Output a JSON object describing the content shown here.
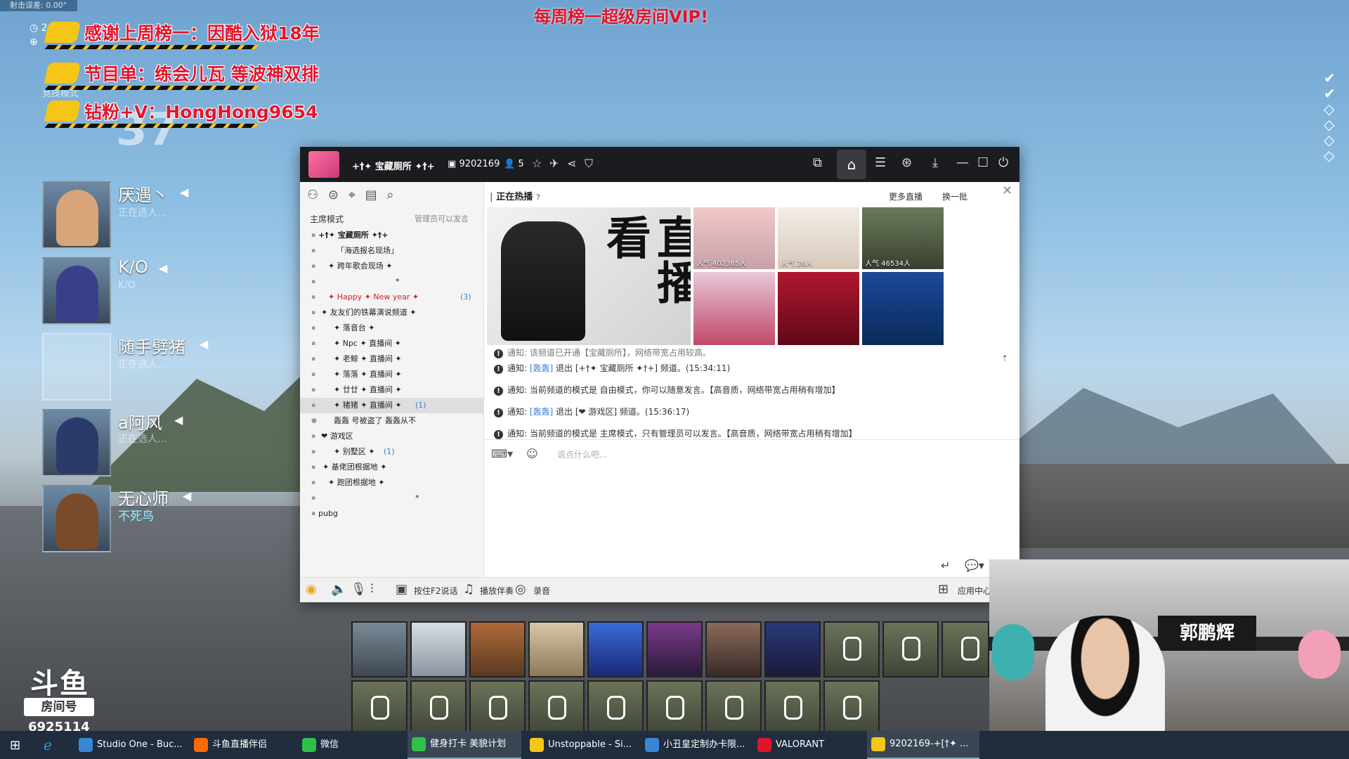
{
  "overlay": {
    "top_banner": "每周榜一超级房间VIP!",
    "tiny_label": "射击误差: 0.00°",
    "ticker": [
      "感谢上周榜一：因酷入狱18年",
      "节目单：练会儿瓦 等波神双排",
      "钻粉+V：HongHong9654"
    ],
    "hud_mode": "竞技模式",
    "hud_number": "37",
    "hud_time": "24"
  },
  "team": [
    {
      "name": "厌遇丶",
      "sub": "正在选人..."
    },
    {
      "name": "K/O",
      "sub": "K/O"
    },
    {
      "name": "随手劈猪",
      "sub": "正在选人..."
    },
    {
      "name": "a阿风",
      "sub": "正在选人..."
    },
    {
      "name": "无心师",
      "sub": "不死鸟"
    }
  ],
  "douyu": {
    "logo": "斗鱼",
    "room_label": "房间号",
    "room_number": "6925114"
  },
  "yy": {
    "title": "+†✦ 宝藏厕所 ✦†+",
    "channel_id": "9202169",
    "online": "5",
    "mode": "主席模式",
    "admin_note": "管理员可以发言",
    "tree": [
      {
        "text": "+†✦ 宝藏厕所 ✦†+",
        "indent": 26,
        "bold": true
      },
      {
        "text": "「海选报名现场」",
        "indent": 52
      },
      {
        "text": "✦ 跨年歌会现场 ✦",
        "indent": 40
      },
      {
        "text": "*",
        "indent": 136
      },
      {
        "text": "✦ Happy ✦ New year ✦",
        "indent": 40,
        "red": true,
        "count": "(3)"
      },
      {
        "text": "✦ 友友们的铁幕演说频道 ✦",
        "indent": 30
      },
      {
        "text": "✦ 落音台 ✦",
        "indent": 48
      },
      {
        "text": "✦ Npc ✦ 直播间 ✦",
        "indent": 48
      },
      {
        "text": "✦ 老鲸 ✦ 直播间 ✦",
        "indent": 48
      },
      {
        "text": "✦ 落落 ✦ 直播间 ✦",
        "indent": 48
      },
      {
        "text": "✦ 廿廿 ✦ 直播间 ✦",
        "indent": 48
      },
      {
        "text": "✦ 猪猪 ✦ 直播间 ✦",
        "indent": 48,
        "count": "(1)",
        "sel": true
      },
      {
        "text": "轰轰 号被盗了 轰轰从不",
        "indent": 48,
        "user": true
      },
      {
        "text": "❤ 游戏区",
        "indent": 30
      },
      {
        "text": "✦ 别墅区 ✦",
        "indent": 48,
        "count": "(1)"
      },
      {
        "text": "✦ 基佬团根据地 ✦",
        "indent": 32
      },
      {
        "text": "✦ 跑团根据地 ✦",
        "indent": 40
      },
      {
        "text": "*",
        "indent": 164
      },
      {
        "text": "pubg",
        "indent": 26
      }
    ],
    "hot": {
      "title": "正在热播",
      "more": "更多直播",
      "refresh": "换一批",
      "big_text": "直播看",
      "viewers": [
        "人气 402365人",
        "人气 26人",
        "人气 46534人"
      ]
    },
    "messages": [
      {
        "pre": "通知: ",
        "name": "",
        "text": "该频道已开通【宝藏厕所】，网络带宽占用较高。"
      },
      {
        "pre": "通知: ",
        "name": "[轰轰]",
        "text": " 退出 [+†✦ 宝藏厕所 ✦†+] 频道。(15:34:11)"
      },
      {
        "pre": "通知: ",
        "name": "",
        "text": "当前频道的模式是 自由模式，你可以随意发言。【高音质，网络带宽占用稍有增加】"
      },
      {
        "pre": "通知: ",
        "name": "[轰轰]",
        "text": " 退出 [❤ 游戏区] 频道。(15:36:17)"
      },
      {
        "pre": "通知: ",
        "name": "",
        "text": "当前频道的模式是 主席模式，只有管理员可以发言。【高音质，网络带宽占用稍有增加】"
      }
    ],
    "input_placeholder": "说点什么吧...",
    "bottom": {
      "f2": "按住F2说话",
      "accompany": "播放伴奏",
      "record": "录音",
      "apps": "应用中心"
    }
  },
  "cam": {
    "sign": "郭鹏辉"
  },
  "taskbar": [
    {
      "label": "Studio One - Buc...",
      "color": "#3a86d6"
    },
    {
      "label": "斗鱼直播伴侣",
      "color": "#ff6a00"
    },
    {
      "label": "微信",
      "color": "#2ec14a"
    },
    {
      "label": "健身打卡 美貌计划",
      "color": "#2ec14a",
      "active": true
    },
    {
      "label": "Unstoppable - Si...",
      "color": "#f5c518"
    },
    {
      "label": "小丑皇定制办卡限...",
      "color": "#3a86d6"
    },
    {
      "label": "VALORANT",
      "color": "#e0142b"
    },
    {
      "label": "9202169-+[†✦ ...",
      "color": "#f5c518",
      "active": true
    }
  ]
}
